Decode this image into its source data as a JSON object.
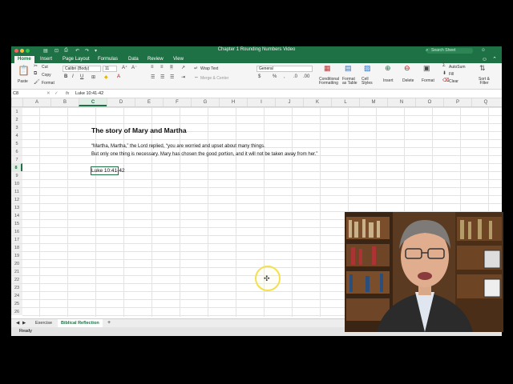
{
  "window": {
    "title": "Chapter 1 Rounding Numbers Video",
    "search_placeholder": "Search Sheet"
  },
  "tabs": [
    "Home",
    "Insert",
    "Page Layout",
    "Formulas",
    "Data",
    "Review",
    "View"
  ],
  "active_tab": "Home",
  "ribbon": {
    "paste": "Paste",
    "cut": "Cut",
    "copy": "Copy",
    "format_painter": "Format",
    "font_name": "Calibri (Body)",
    "font_size": "11",
    "wrap_text": "Wrap Text",
    "merge_center": "Merge & Center",
    "number_format": "General",
    "conditional_formatting": "Conditional Formatting",
    "format_as_table": "Format as Table",
    "cell_styles": "Cell Styles",
    "insert": "Insert",
    "delete": "Delete",
    "format": "Format",
    "autosum": "AutoSum",
    "fill": "Fill",
    "clear": "Clear",
    "sort_filter": "Sort & Filter"
  },
  "formula_bar": {
    "name_box": "C8",
    "fx": "fx",
    "content": "Luke 10:41-42"
  },
  "columns": [
    "A",
    "B",
    "C",
    "D",
    "E",
    "F",
    "G",
    "H",
    "I",
    "J",
    "K",
    "L",
    "M",
    "N",
    "O",
    "P",
    "Q"
  ],
  "rows": [
    "1",
    "2",
    "3",
    "4",
    "5",
    "6",
    "7",
    "8",
    "9",
    "10",
    "11",
    "12",
    "13",
    "14",
    "15",
    "16",
    "17",
    "18",
    "19",
    "20",
    "21",
    "22",
    "23",
    "24",
    "25",
    "26"
  ],
  "selected_column": "C",
  "selected_row": "8",
  "cells": {
    "C3": "The story of Mary and Martha",
    "C5": "“Martha, Martha,” the Lord replied, “you are worried and upset about many things.",
    "C6": "But only one thing is necessary. Mary has chosen the good portion, and it will not be taken away from her.”",
    "C8": "Luke 10:41-42"
  },
  "sheet_tabs": [
    "Exercise",
    "Biblical Reflection"
  ],
  "active_sheet": "Biblical Reflection",
  "status": "Ready",
  "colors": {
    "excel_green": "#1e7145",
    "cursor_highlight": "#f4e04d"
  }
}
